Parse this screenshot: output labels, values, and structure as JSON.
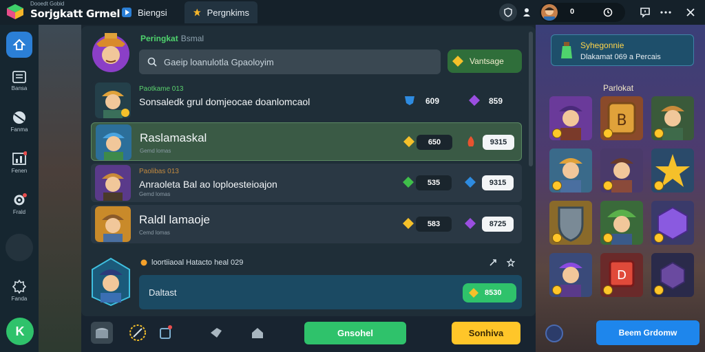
{
  "app": {
    "subtitle": "Dooedt Gobid",
    "title": "Sorjgkatt Grmel"
  },
  "tabs": [
    {
      "label": "Biengsi"
    },
    {
      "label": "Pergnkims"
    }
  ],
  "header_status": {
    "value_1": "0",
    "value_2": "0"
  },
  "sidebar": {
    "items": [
      {
        "label": "Bansa",
        "icon": "document-icon"
      },
      {
        "label": "Fanma",
        "icon": "ball-icon"
      },
      {
        "label": "Fenen",
        "icon": "chart-icon"
      },
      {
        "label": "Frald",
        "icon": "gear-icon"
      },
      {
        "label": "Fanda",
        "icon": "settings-icon"
      }
    ],
    "bottom_label": "K"
  },
  "panel": {
    "title": "Peringkat",
    "title_sub": "Bsmal",
    "search_placeholder": "Gaeip loanulotla Gpaoloyim",
    "top_button": "Vantsage"
  },
  "rows": [
    {
      "meta": "Paotkame 013",
      "name": "Sonsaledk grul domjeocae doanlomcaol",
      "sub": "",
      "stat1": "609",
      "stat2": "859"
    },
    {
      "meta": "",
      "name": "Raslamaskal",
      "sub": "Gemd lomas",
      "stat1": "650",
      "stat2": "9315"
    },
    {
      "meta": "Paolibas 013",
      "name": "Anraoleta Bal ao loploesteioajon",
      "sub": "Gemd lomas",
      "stat1": "535",
      "stat2": "9315"
    },
    {
      "meta": "",
      "name": "Raldl lamaoje",
      "sub": "Cemd lomas",
      "stat1": "583",
      "stat2": "8725"
    }
  ],
  "task": {
    "meta": "loortiiaoal Hatacto heal 029",
    "label": "Daltast",
    "button": "8530"
  },
  "bottom": {
    "primary": "Gnsohel",
    "secondary": "Sonhiva"
  },
  "right_panel": {
    "notice_title": "Syhegonnie",
    "notice_text": "Dlakamat 069 a Percais",
    "grid_title": "Parlokat",
    "orders_button": "Beem Grdomw"
  },
  "colors": {
    "accent_green": "#2fc26b",
    "accent_blue": "#1e86ec",
    "accent_yellow": "#ffc629",
    "panel_bg": "#1f2e38"
  }
}
